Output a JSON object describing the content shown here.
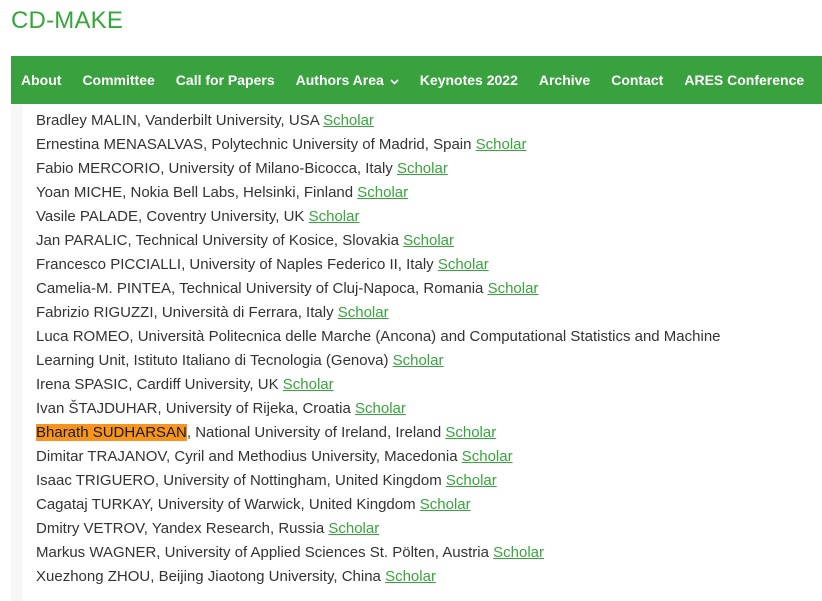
{
  "site": {
    "title": "CD-MAKE"
  },
  "nav": [
    {
      "label": "About"
    },
    {
      "label": "Committee"
    },
    {
      "label": "Call for Papers"
    },
    {
      "label": "Authors Area",
      "dropdown": true
    },
    {
      "label": "Keynotes 2022"
    },
    {
      "label": "Archive"
    },
    {
      "label": "Contact"
    },
    {
      "label": "ARES Conference"
    }
  ],
  "link_text": "Scholar",
  "members": [
    {
      "name": "Bradley MALIN",
      "affiliation": ", Vanderbilt University, USA "
    },
    {
      "name": "Ernestina MENASALVAS",
      "affiliation": ", Polytechnic University of Madrid, Spain "
    },
    {
      "name": "Fabio MERCORIO",
      "affiliation": ", University of Milano-Bicocca, Italy "
    },
    {
      "name": "Yoan MICHE",
      "affiliation": ", Nokia Bell Labs, Helsinki, Finland "
    },
    {
      "name": "Vasile PALADE",
      "affiliation": ", Coventry University, UK "
    },
    {
      "name": "Jan PARALIC",
      "affiliation": ", Technical University of Kosice, Slovakia "
    },
    {
      "name": "Francesco PICCIALLI",
      "affiliation": ", University of Naples Federico II, Italy "
    },
    {
      "name": "Camelia-M. PINTEA",
      "affiliation": ", Technical University of Cluj-Napoca, Romania "
    },
    {
      "name": "Fabrizio RIGUZZI",
      "affiliation": ", Università di Ferrara, Italy "
    },
    {
      "name": "Luca ROMEO",
      "affiliation": ", Università Politecnica delle Marche (Ancona) and Computational Statistics and Machine",
      "affiliation_line2": "Learning Unit, Istituto Italiano di Tecnologia (Genova) "
    },
    {
      "name": "Irena SPASIC",
      "affiliation": ", Cardiff University, UK "
    },
    {
      "name": "Ivan ŠTAJDUHAR",
      "affiliation": ", University of Rijeka, Croatia "
    },
    {
      "name": "Bharath SUDHARSAN",
      "affiliation": ", National University of Ireland, Ireland ",
      "highlighted": true
    },
    {
      "name": "Dimitar TRAJANOV",
      "affiliation": ", Cyril and Methodius University, Macedonia "
    },
    {
      "name": "Isaac TRIGUERO",
      "affiliation": ", University of Nottingham, United Kingdom "
    },
    {
      "name": "Cagataj TURKAY",
      "affiliation": ", University of Warwick, United Kingdom "
    },
    {
      "name": "Dmitry VETROV",
      "affiliation": ", Yandex Research, Russia "
    },
    {
      "name": "Markus WAGNER",
      "affiliation": ", University of Applied Sciences St. Pölten, Austria "
    },
    {
      "name": "Xuezhong ZHOU",
      "affiliation": ", Beijing Jiaotong University, China "
    }
  ],
  "colors": {
    "brand": "#3aa13f",
    "link": "#35a63a",
    "highlight": "#f7941d"
  }
}
